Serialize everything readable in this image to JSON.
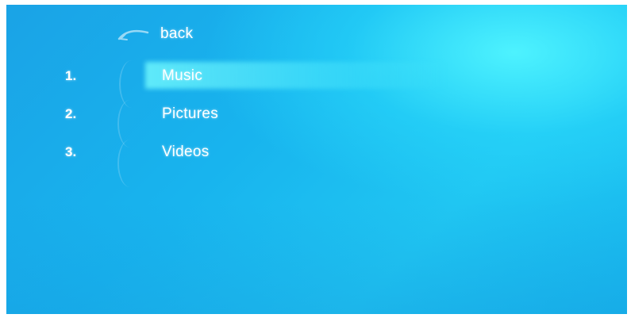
{
  "nav": {
    "back_label": "back",
    "back_icon": "back-arrow-icon"
  },
  "menu": {
    "selected_index": 0,
    "items": [
      {
        "number": "1.",
        "label": "Music"
      },
      {
        "number": "2.",
        "label": "Pictures"
      },
      {
        "number": "3.",
        "label": "Videos"
      }
    ]
  },
  "theme": {
    "background": "#1aa3e6",
    "glow": "#50f5ff",
    "text": "#ffffff"
  }
}
